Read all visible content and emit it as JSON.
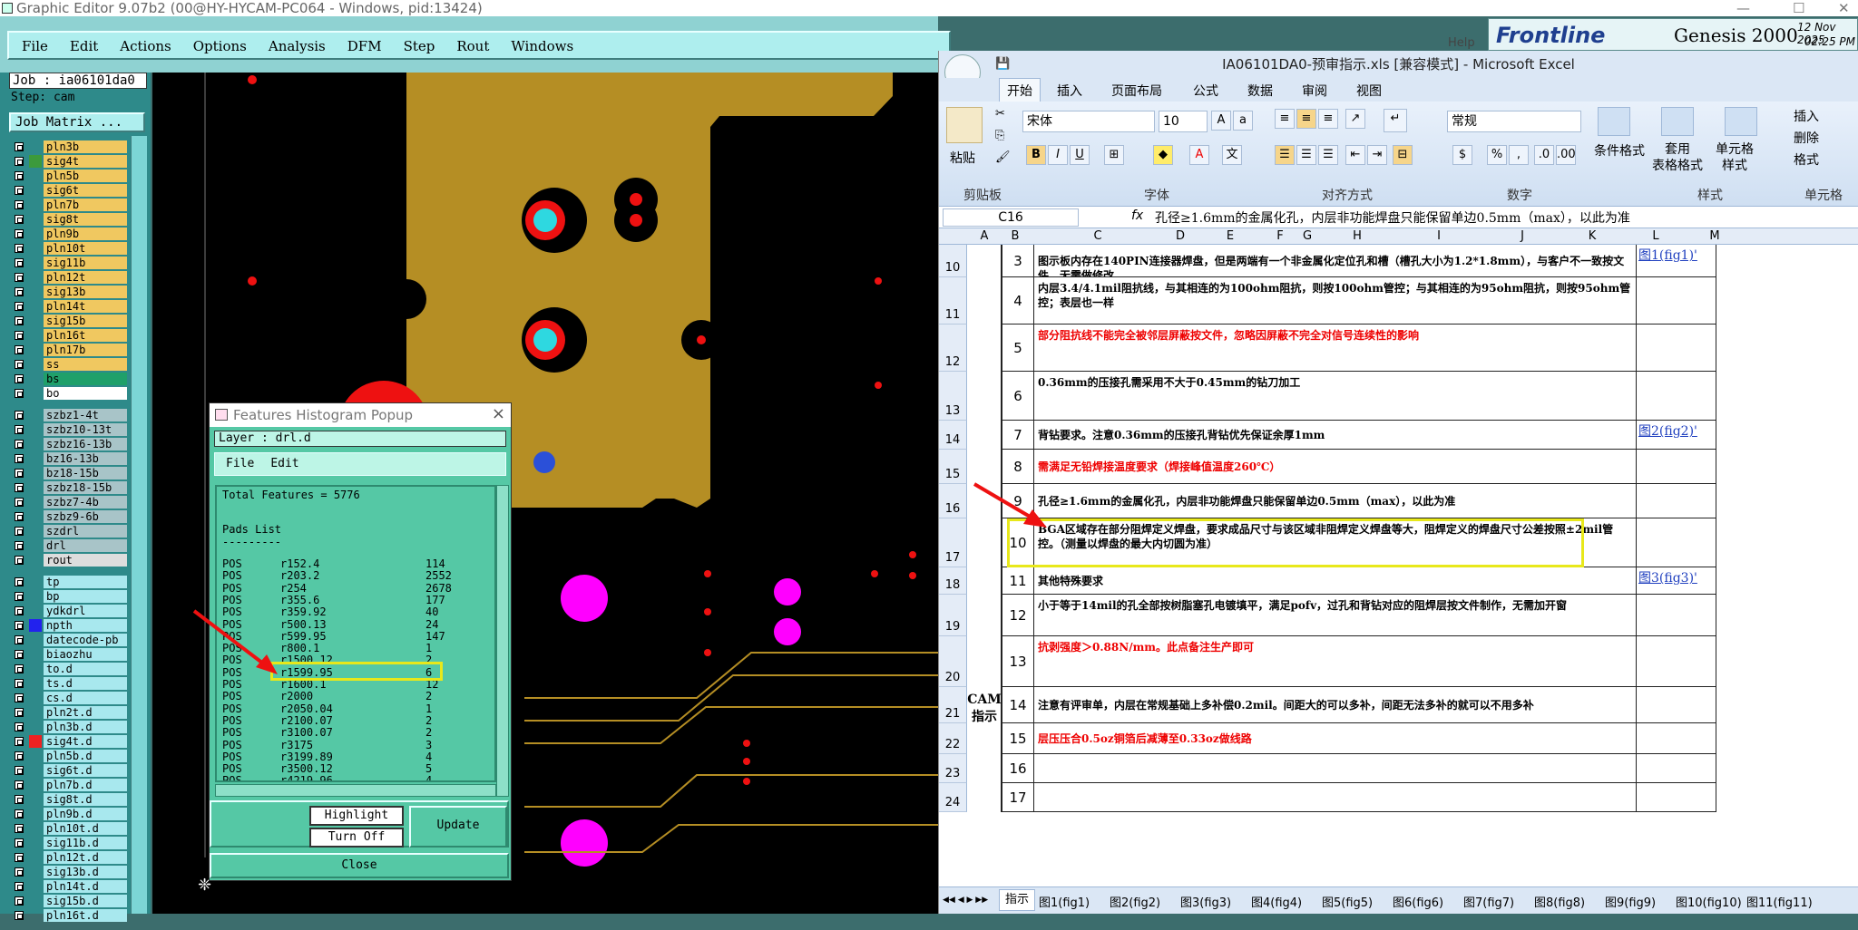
{
  "window": {
    "title": "Graphic Editor 9.07b2 (00@HY-HYCAM-PC064 - Windows, pid:13424)",
    "min": "—",
    "max": "☐",
    "close": "✕"
  },
  "menu": [
    "File",
    "Edit",
    "Actions",
    "Options",
    "Analysis",
    "DFM",
    "Step",
    "Rout",
    "Windows"
  ],
  "help": "Help",
  "brand": {
    "logo": "Frontline",
    "product": "Genesis 2000",
    "date": "12 Nov 2025",
    "time": "02:25 PM"
  },
  "job": {
    "label": "Job : ia06101da0",
    "step": "Step: cam",
    "matrix_button": "Job Matrix ..."
  },
  "layers_group1": [
    {
      "name": "pln3b",
      "color": "#f0c860"
    },
    {
      "name": "sig4t",
      "color": "#f0c860",
      "sw": "#3c9a3c"
    },
    {
      "name": "pln5b",
      "color": "#f0c860"
    },
    {
      "name": "sig6t",
      "color": "#f0c860"
    },
    {
      "name": "pln7b",
      "color": "#f0c860"
    },
    {
      "name": "sig8t",
      "color": "#f0c860"
    },
    {
      "name": "pln9b",
      "color": "#f0c860"
    },
    {
      "name": "pln10t",
      "color": "#f0c860"
    },
    {
      "name": "sig11b",
      "color": "#f0c860"
    },
    {
      "name": "pln12t",
      "color": "#f0c860"
    },
    {
      "name": "sig13b",
      "color": "#f0c860"
    },
    {
      "name": "pln14t",
      "color": "#f0c860"
    },
    {
      "name": "sig15b",
      "color": "#f0c860"
    },
    {
      "name": "pln16t",
      "color": "#f0c860"
    },
    {
      "name": "pln17b",
      "color": "#f0c860"
    },
    {
      "name": "ss",
      "color": "#f0c860"
    },
    {
      "name": "bs",
      "color": "#1fa06a"
    },
    {
      "name": "bo",
      "color": "#ffffff"
    }
  ],
  "layers_group2": [
    {
      "name": "szbz1-4t",
      "color": "#a8c4c8"
    },
    {
      "name": "szbz10-13t",
      "color": "#a8c4c8"
    },
    {
      "name": "szbz16-13b",
      "color": "#a8c4c8"
    },
    {
      "name": "bz16-13b",
      "color": "#a8c4c8"
    },
    {
      "name": "bz18-15b",
      "color": "#a8c4c8"
    },
    {
      "name": "szbz18-15b",
      "color": "#a8c4c8"
    },
    {
      "name": "szbz7-4b",
      "color": "#a8c4c8"
    },
    {
      "name": "szbz9-6b",
      "color": "#a8c4c8"
    },
    {
      "name": "szdrl",
      "color": "#a8c4c8"
    },
    {
      "name": "drl",
      "color": "#a8c4c8"
    },
    {
      "name": "rout",
      "color": "#dddddd"
    }
  ],
  "layers_group3": [
    {
      "name": "tp",
      "color": "#a8e8ee"
    },
    {
      "name": "bp",
      "color": "#a8e8ee"
    },
    {
      "name": "ydkdrl",
      "color": "#a8e8ee"
    },
    {
      "name": "npth",
      "color": "#a8e8ee",
      "sw": "#2222ee"
    },
    {
      "name": "datecode-pb",
      "color": "#a8e8ee"
    },
    {
      "name": "biaozhu",
      "color": "#a8e8ee"
    },
    {
      "name": "to.d",
      "color": "#a8e8ee"
    },
    {
      "name": "ts.d",
      "color": "#a8e8ee"
    },
    {
      "name": "cs.d",
      "color": "#a8e8ee"
    },
    {
      "name": "pln2t.d",
      "color": "#a8e8ee"
    },
    {
      "name": "pln3b.d",
      "color": "#a8e8ee"
    },
    {
      "name": "sig4t.d",
      "color": "#a8e8ee",
      "sw": "#ee2222"
    },
    {
      "name": "pln5b.d",
      "color": "#a8e8ee"
    },
    {
      "name": "sig6t.d",
      "color": "#a8e8ee"
    },
    {
      "name": "pln7b.d",
      "color": "#a8e8ee"
    },
    {
      "name": "sig8t.d",
      "color": "#a8e8ee"
    },
    {
      "name": "pln9b.d",
      "color": "#a8e8ee"
    },
    {
      "name": "pln10t.d",
      "color": "#a8e8ee"
    },
    {
      "name": "sig11b.d",
      "color": "#a8e8ee"
    },
    {
      "name": "pln12t.d",
      "color": "#a8e8ee"
    },
    {
      "name": "sig13b.d",
      "color": "#a8e8ee"
    },
    {
      "name": "pln14t.d",
      "color": "#a8e8ee"
    },
    {
      "name": "sig15b.d",
      "color": "#a8e8ee"
    },
    {
      "name": "pln16t.d",
      "color": "#a8e8ee"
    }
  ],
  "popup": {
    "title": "Features Histogram Popup",
    "layer": "Layer :  drl.d",
    "menu": [
      "File",
      "Edit"
    ],
    "total": "Total Features = 5776",
    "pads_header": "Pads List",
    "dashes": "---------",
    "rows": [
      {
        "pol": "POS",
        "sym": "r152.4",
        "count": "114"
      },
      {
        "pol": "POS",
        "sym": "r203.2",
        "count": "2552"
      },
      {
        "pol": "POS",
        "sym": "r254",
        "count": "2678"
      },
      {
        "pol": "POS",
        "sym": "r355.6",
        "count": "177"
      },
      {
        "pol": "POS",
        "sym": "r359.92",
        "count": "40"
      },
      {
        "pol": "POS",
        "sym": "r500.13",
        "count": "24"
      },
      {
        "pol": "POS",
        "sym": "r599.95",
        "count": "147"
      },
      {
        "pol": "POS",
        "sym": "r800.1",
        "count": "1"
      },
      {
        "pol": "POS",
        "sym": "r1500.12",
        "count": "2"
      },
      {
        "pol": "POS",
        "sym": "r1599.95",
        "count": "6"
      },
      {
        "pol": "POS",
        "sym": "r1600.1",
        "count": "12"
      },
      {
        "pol": "POS",
        "sym": "r2000",
        "count": "2"
      },
      {
        "pol": "POS",
        "sym": "r2050.04",
        "count": "1"
      },
      {
        "pol": "POS",
        "sym": "r2100.07",
        "count": "2"
      },
      {
        "pol": "POS",
        "sym": "r3100.07",
        "count": "2"
      },
      {
        "pol": "POS",
        "sym": "r3175",
        "count": "3"
      },
      {
        "pol": "POS",
        "sym": "r3199.89",
        "count": "4"
      },
      {
        "pol": "POS",
        "sym": "r3500.12",
        "count": "5"
      },
      {
        "pol": "POS",
        "sym": "r4219.96",
        "count": "4"
      }
    ],
    "highlight_btn": "Highlight",
    "turnoff_btn": "Turn Off",
    "update_btn": "Update",
    "close_btn": "Close"
  },
  "excel": {
    "title": "IA06101DA0-预审指示.xls  [兼容模式] - Microsoft Excel",
    "tabs": [
      "开始",
      "插入",
      "页面布局",
      "公式",
      "数据",
      "审阅",
      "视图"
    ],
    "font_name": "宋体",
    "font_size": "10",
    "number_format": "常规",
    "groups": [
      "剪贴板",
      "字体",
      "对齐方式",
      "数字",
      "样式",
      "单元格"
    ],
    "paste": "粘贴",
    "cond_format": "条件格式",
    "table_format": "套用\n表格格式",
    "cell_style": "单元格\n样式",
    "insert": "插入",
    "delete": "删除",
    "format": "格式",
    "name_box": "C16",
    "fx": "fx",
    "formula": "孔径≥1.6mm的金属化孔，内层非功能焊盘只能保留单边0.5mm（max），以此为准",
    "columns": [
      "A",
      "B",
      "C",
      "D",
      "E",
      "F",
      "G",
      "H",
      "I",
      "J",
      "K",
      "L",
      "M"
    ],
    "side_label": "CAM\n指示",
    "rows": [
      {
        "row": "10",
        "num": "3",
        "text": "图示板内存在140PIN连接器焊盘，但是两端有一个非金属化定位孔和槽（槽孔大小为1.2*1.8mm），与客户不一致按文件，无需做修改",
        "red": false,
        "link": "图1(fig1)'"
      },
      {
        "row": "11",
        "num": "4",
        "text": "内层3.4/4.1mil阻抗线，与其相连的为100ohm阻抗，则按100ohm管控；与其相连的为95ohm阻抗，则按95ohm管控；表层也一样",
        "red": false,
        "link": ""
      },
      {
        "row": "12",
        "num": "5",
        "text": "部分阻抗线不能完全被邻层屏蔽按文件，忽略因屏蔽不完全对信号连续性的影响",
        "red": true,
        "link": ""
      },
      {
        "row": "13",
        "num": "6",
        "text": "0.36mm的压接孔需采用不大于0.45mm的钻刀加工",
        "red": false,
        "link": ""
      },
      {
        "row": "14",
        "num": "7",
        "text": "背钻要求。注意0.36mm的压接孔背钻优先保证余厚1mm",
        "red": false,
        "link": "图2(fig2)'"
      },
      {
        "row": "15",
        "num": "8",
        "text": "需满足无铅焊接温度要求（焊接峰值温度260℃）",
        "red": true,
        "link": ""
      },
      {
        "row": "16",
        "num": "9",
        "text": "孔径≥1.6mm的金属化孔，内层非功能焊盘只能保留单边0.5mm（max），以此为准",
        "red": false,
        "link": ""
      },
      {
        "row": "17",
        "num": "10",
        "text": "BGA区域存在部分阻焊定义焊盘，要求成品尺寸与该区域非阻焊定义焊盘等大，阻焊定义的焊盘尺寸公差按照±2mil管控。（测量以焊盘的最大内切圆为准）",
        "red": false,
        "link": ""
      },
      {
        "row": "18",
        "num": "11",
        "text": "其他特殊要求",
        "red": false,
        "link": "图3(fig3)'"
      },
      {
        "row": "19",
        "num": "12",
        "text": "小于等于14mil的孔全部按树脂塞孔电镀填平，满足pofv，过孔和背钻对应的阻焊层按文件制作，无需加开窗",
        "red": false,
        "link": ""
      },
      {
        "row": "20",
        "num": "13",
        "text": "抗剥强度＞0.88N/mm。此点备注生产即可",
        "red": true,
        "link": ""
      },
      {
        "row": "21",
        "num": "14",
        "text": "注意有评审单，内层在常规基础上多补偿0.2mil。间距大的可以多补，间距无法多补的就可以不用多补",
        "red": false,
        "link": ""
      },
      {
        "row": "22",
        "num": "15",
        "text": "层压压合0.5oz铜箔后减薄至0.33oz做线路",
        "red": true,
        "link": ""
      },
      {
        "row": "23",
        "num": "16",
        "text": "",
        "red": false,
        "link": ""
      },
      {
        "row": "24",
        "num": "17",
        "text": "",
        "red": false,
        "link": ""
      }
    ],
    "sheets": [
      "指示",
      "图1(fig1)",
      "图2(fig2)",
      "图3(fig3)",
      "图4(fig4)",
      "图5(fig5)",
      "图6(fig6)",
      "图7(fig7)",
      "图8(fig8)",
      "图9(fig9)",
      "图10(fig10)",
      "图11(fig11)"
    ]
  }
}
